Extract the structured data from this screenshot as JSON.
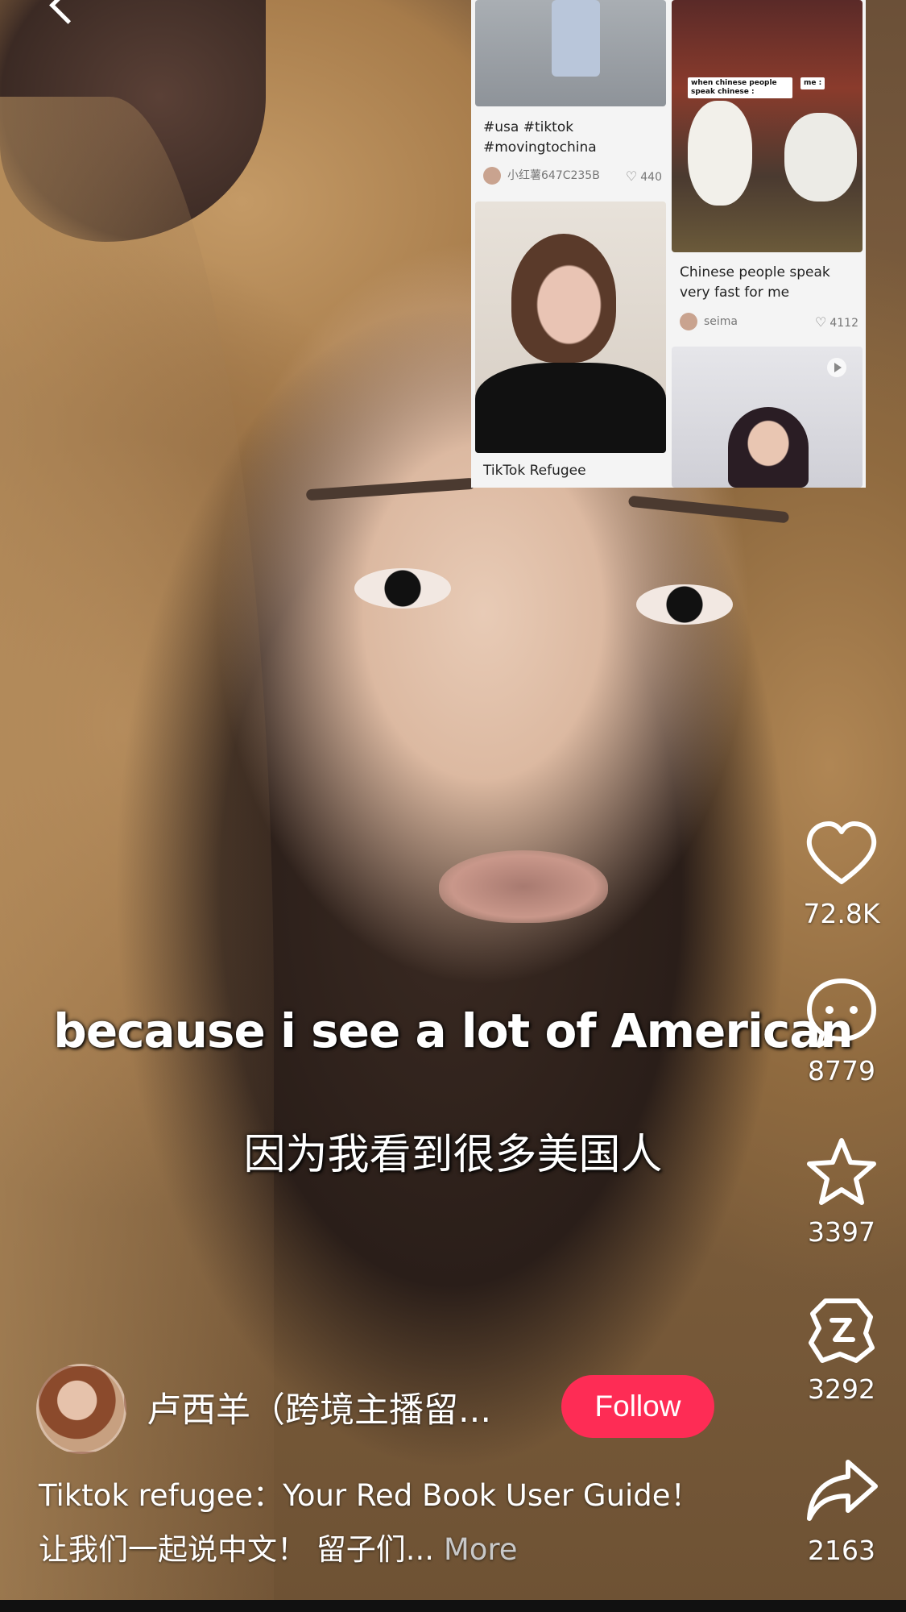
{
  "feed": {
    "cards": [
      {
        "caption": "#usa #tiktok #movingtochina",
        "author": "小红薯647C235B",
        "likes": "440"
      },
      {
        "caption": "TikTok Refugee"
      },
      {
        "caption": "Chinese people speak very fast for me",
        "author": "seima",
        "likes": "4112",
        "meme_left": "when chinese people speak chinese :",
        "meme_right": "me :"
      }
    ]
  },
  "subtitles": {
    "english": "because i see a lot of American",
    "chinese": "因为我看到很多美国人"
  },
  "actions": {
    "likes": "72.8K",
    "comments": "8779",
    "favorites": "3397",
    "shares_alt": "3292",
    "shares": "2163"
  },
  "creator": {
    "name": "卢西羊（跨境主播留...",
    "follow_label": "Follow"
  },
  "description": {
    "text": "Tiktok refugee：Your Red Book User Guide！ 让我们一起说中文！ 留子们...",
    "more_label": "More"
  },
  "colors": {
    "follow_button": "#fe2c55",
    "overlay_bg": "#f4f4f4"
  }
}
